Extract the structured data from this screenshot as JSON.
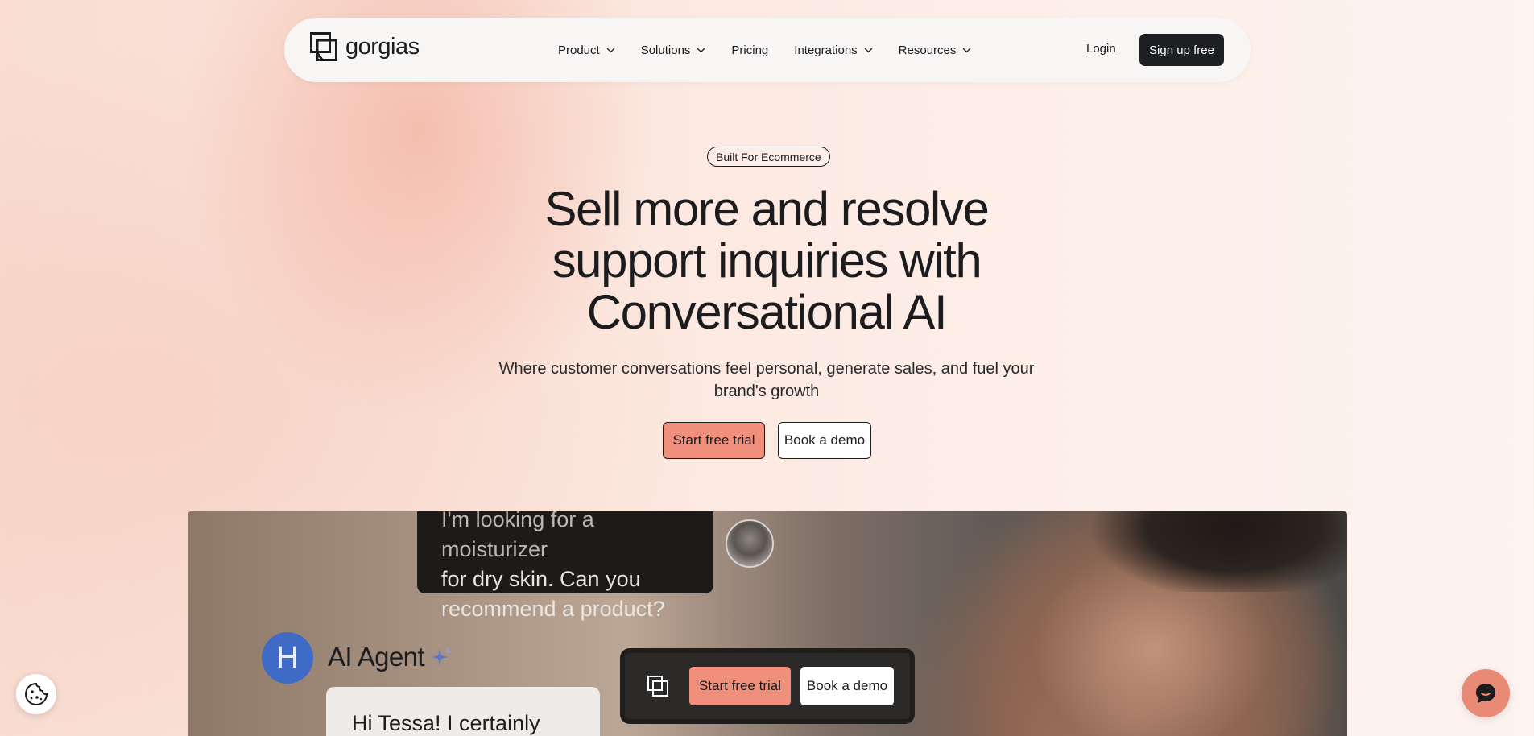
{
  "nav": {
    "logo_text": "gorgias",
    "links": [
      {
        "label": "Product",
        "has_dropdown": true
      },
      {
        "label": "Solutions",
        "has_dropdown": true
      },
      {
        "label": "Pricing",
        "has_dropdown": false
      },
      {
        "label": "Integrations",
        "has_dropdown": true
      },
      {
        "label": "Resources",
        "has_dropdown": true
      }
    ],
    "login": "Login",
    "signup": "Sign up free"
  },
  "hero": {
    "badge": "Built For Ecommerce",
    "headline_line1": "Sell more and resolve",
    "headline_line2": "support inquiries with",
    "headline_line3": "Conversational AI",
    "subheading": "Where customer conversations feel personal, generate sales, and fuel your brand's growth",
    "cta_primary": "Start free trial",
    "cta_secondary": "Book a demo"
  },
  "media": {
    "user_message_line1": "I'm looking for a moisturizer",
    "user_message_line2": "for dry skin. Can you",
    "user_message_line3": "recommend a product?",
    "ai_avatar_letter": "H",
    "ai_name": "AI Agent",
    "ai_message": "Hi Tessa! I certainly can.",
    "float_cta_primary": "Start free trial",
    "float_cta_secondary": "Book a demo"
  },
  "colors": {
    "accent": "#ef8f7c",
    "dark": "#1e1f22",
    "ai_avatar": "#3f6bc6",
    "chat_button": "#e88a75"
  },
  "icons": {
    "logo": "gorgias-logo-icon",
    "dropdown": "chevron-down-icon",
    "sparkle": "sparkle-icon",
    "cookie": "cookie-icon",
    "chat": "chat-bubble-icon"
  }
}
